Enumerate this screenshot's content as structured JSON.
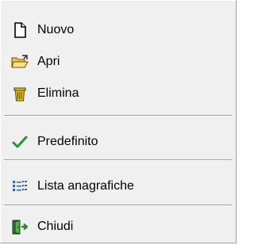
{
  "menu": {
    "items": [
      {
        "label": "Nuovo",
        "icon": "new-document-icon"
      },
      {
        "label": "Apri",
        "icon": "open-folder-icon"
      },
      {
        "label": "Elimina",
        "icon": "trash-icon"
      },
      {
        "label": "Predefinito",
        "icon": "checkmark-icon"
      },
      {
        "label": "Lista anagrafiche",
        "icon": "list-icon"
      },
      {
        "label": "Chiudi",
        "icon": "exit-door-icon"
      }
    ]
  },
  "colors": {
    "menu_background": "#f0f0f0",
    "separator": "#a0a0a0",
    "check_green": "#1d9a2b",
    "folder_yellow": "#f6c33a",
    "trash_yellow": "#f2c500",
    "list_blue": "#2f5fd0",
    "door_green": "#2f7f2f"
  }
}
